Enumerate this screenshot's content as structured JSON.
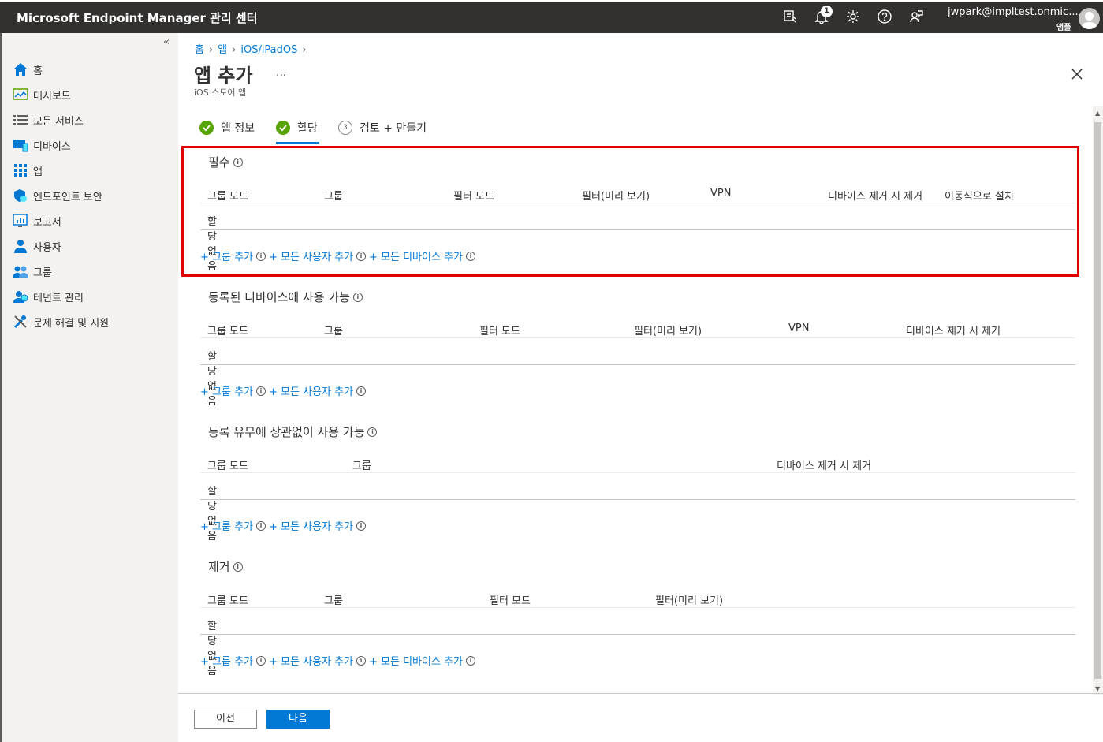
{
  "topbar": {
    "title": "Microsoft Endpoint Manager 관리 센터",
    "notification_count": "1",
    "user_email": "jwpark@impltest.onmic...",
    "user_tenant": "앰플"
  },
  "sidebar": {
    "collapse_label": "«",
    "items": [
      {
        "label": "홈",
        "icon": "home-icon"
      },
      {
        "label": "대시보드",
        "icon": "dashboard-icon"
      },
      {
        "label": "모든 서비스",
        "icon": "list-icon"
      },
      {
        "label": "디바이스",
        "icon": "devices-icon"
      },
      {
        "label": "앱",
        "icon": "apps-icon"
      },
      {
        "label": "엔드포인트 보안",
        "icon": "shield-icon"
      },
      {
        "label": "보고서",
        "icon": "reports-icon"
      },
      {
        "label": "사용자",
        "icon": "user-icon"
      },
      {
        "label": "그룹",
        "icon": "group-icon"
      },
      {
        "label": "테넌트 관리",
        "icon": "tenant-icon"
      },
      {
        "label": "문제 해결 및 지원",
        "icon": "wrench-icon"
      }
    ]
  },
  "breadcrumb": [
    "홈",
    "앱",
    "iOS/iPadOS"
  ],
  "page": {
    "title": "앱 추가",
    "more": "...",
    "subtitle": "iOS 스토어 앱"
  },
  "steps": [
    {
      "label": "앱 정보",
      "state": "done"
    },
    {
      "label": "할당",
      "state": "done"
    },
    {
      "label": "검토 + 만들기",
      "state": "pending",
      "number": "3"
    }
  ],
  "sections": [
    {
      "title": "필수",
      "columns": [
        "그룹 모드",
        "그룹",
        "필터 모드",
        "필터(미리 보기)",
        "VPN",
        "디바이스 제거 시 제거",
        "이동식으로 설치"
      ],
      "empty": "할당 없음",
      "links": [
        "+ 그룹 추가",
        "+ 모든 사용자 추가",
        "+ 모든 디바이스 추가"
      ]
    },
    {
      "title": "등록된 디바이스에 사용 가능",
      "columns": [
        "그룹 모드",
        "그룹",
        "필터 모드",
        "필터(미리 보기)",
        "VPN",
        "디바이스 제거 시 제거"
      ],
      "empty": "할당 없음",
      "links": [
        "+ 그룹 추가",
        "+ 모든 사용자 추가"
      ]
    },
    {
      "title": "등록 유무에 상관없이 사용 가능",
      "columns": [
        "그룹 모드",
        "그룹",
        "디바이스 제거 시 제거"
      ],
      "empty": "할당 없음",
      "links": [
        "+ 그룹 추가",
        "+ 모든 사용자 추가"
      ]
    },
    {
      "title": "제거",
      "columns": [
        "그룹 모드",
        "그룹",
        "필터 모드",
        "필터(미리 보기)"
      ],
      "empty": "할당 없음",
      "links": [
        "+ 그룹 추가",
        "+ 모든 사용자 추가",
        "+ 모든 디바이스 추가"
      ]
    }
  ],
  "footer": {
    "prev_label": "이전",
    "next_label": "다음"
  },
  "colors": {
    "topbar": "#323130",
    "accent": "#0078d4",
    "success": "#57a300",
    "highlight": "#e00000"
  }
}
